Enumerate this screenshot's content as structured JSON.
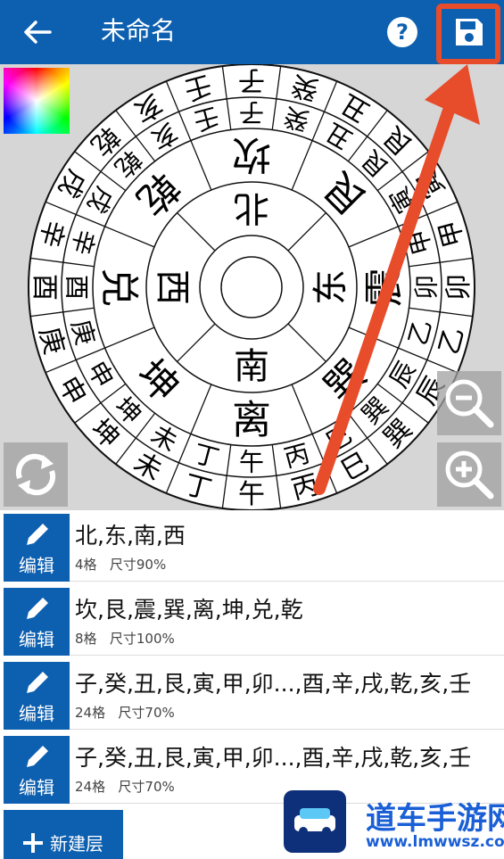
{
  "header": {
    "back_icon": "arrow-left-icon",
    "title": "未命名",
    "help_icon": "question-circle-icon",
    "save_icon": "floppy-disk-icon",
    "bar_color": "#0d5fb0",
    "highlight_color": "#e74c2b"
  },
  "canvas": {
    "background": "#d6d6d6",
    "color_picker_icon": "color-wheel-icon",
    "rotate_icon": "rotate-arrows-icon",
    "zoom_out_icon": "zoom-out-icon",
    "zoom_in_icon": "zoom-in-icon"
  },
  "dial": {
    "rings": [
      {
        "name": "inner",
        "cells": [
          "北",
          "东",
          "南",
          "西"
        ]
      },
      {
        "name": "trigrams",
        "cells": [
          "坎",
          "艮",
          "震",
          "巽",
          "离",
          "坤",
          "兑",
          "乾"
        ]
      },
      {
        "name": "mountains-a",
        "cells": [
          "子",
          "癸",
          "丑",
          "艮",
          "寅",
          "甲",
          "卯",
          "乙",
          "辰",
          "巽",
          "巳",
          "丙",
          "午",
          "丁",
          "未",
          "坤",
          "申",
          "庚",
          "酉",
          "辛",
          "戌",
          "乾",
          "亥",
          "壬"
        ]
      },
      {
        "name": "mountains-b",
        "cells": [
          "子",
          "癸",
          "丑",
          "艮",
          "寅",
          "甲",
          "卯",
          "乙",
          "辰",
          "巽",
          "巳",
          "丙",
          "午",
          "丁",
          "未",
          "坤",
          "申",
          "庚",
          "酉",
          "辛",
          "戌",
          "乾",
          "亥",
          "壬"
        ]
      }
    ]
  },
  "layers": [
    {
      "names": "北,东,南,西",
      "grid": "4格",
      "size": "尺寸90%",
      "edit_label": "编辑"
    },
    {
      "names": "坎,艮,震,巽,离,坤,兑,乾",
      "grid": "8格",
      "size": "尺寸100%",
      "edit_label": "编辑"
    },
    {
      "names": "子,癸,丑,艮,寅,甲,卯...,酉,辛,戌,乾,亥,壬",
      "grid": "24格",
      "size": "尺寸70%",
      "edit_label": "编辑"
    },
    {
      "names": "子,癸,丑,艮,寅,甲,卯...,酉,辛,戌,乾,亥,壬",
      "grid": "24格",
      "size": "尺寸70%",
      "edit_label": "编辑"
    }
  ],
  "add_layer": {
    "label": "新建层",
    "icon": "plus-icon"
  },
  "watermark": {
    "logo_icon": "car-logo-icon",
    "name": "道车手游网",
    "url": "www.lmwwsz.com"
  }
}
